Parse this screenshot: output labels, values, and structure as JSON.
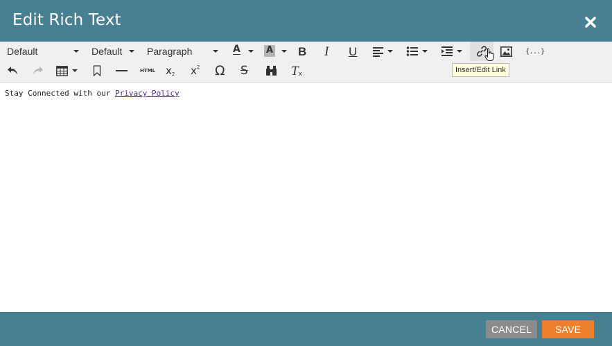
{
  "dialog": {
    "title": "Edit Rich Text"
  },
  "toolbar": {
    "font_family": "Default",
    "font_size": "Default",
    "block_format": "Paragraph",
    "text_color_glyph": "A",
    "bg_color_glyph": "A",
    "bold_glyph": "B",
    "italic_glyph": "I",
    "underline_glyph": "U",
    "html_label": "HTML",
    "omega_glyph": "Ω",
    "strike_glyph": "S",
    "clear_format_glyph": "T",
    "tokens_label": "{...}",
    "subscript_base": "x",
    "superscript_base": "x",
    "clear_format_sub": "x",
    "subscript_index": "2",
    "superscript_index": "2"
  },
  "tooltip": {
    "text": "Insert/Edit Link"
  },
  "editor": {
    "text_before_link": "Stay Connected with our ",
    "link_text": "Privacy Policy"
  },
  "footer": {
    "cancel_label": "CANCEL",
    "save_label": "SAVE"
  },
  "colors": {
    "header": "#477f93",
    "toolbar": "#f0f0f0",
    "cancel": "#8c8c8c",
    "save": "#ee7f2d",
    "link": "#4b2a86",
    "tooltip_bg": "#ffffdd"
  }
}
